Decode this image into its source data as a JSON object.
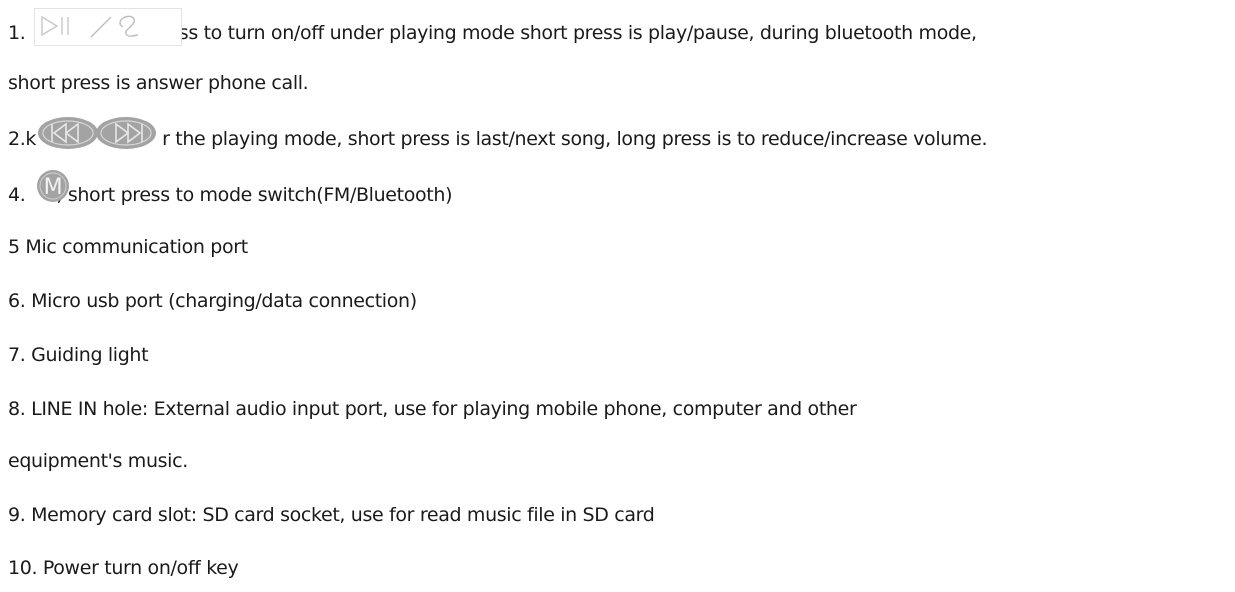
{
  "lines": {
    "l1_prefix": "1.",
    "l1_rest": "ess to turn on/off under playing mode short press is play/pause, during bluetooth mode,",
    "l2": "short press is answer phone call.",
    "l3_prefix": "2.k",
    "l3_rest": "r the playing mode, short press is last/next song, long press is to reduce/increase volume.",
    "l4_prefix": "4.",
    "l4_rest": ", short press to mode switch(FM/Bluetooth)",
    "l5": "5 Mic communication port",
    "l6": "6. Micro usb  port (charging/data connection)",
    "l7": "7. Guiding light",
    "l8": "8. LINE IN hole: External audio input port, use for playing mobile phone, computer and other",
    "l9": "equipment's music.",
    "l10": "9. Memory card slot: SD card socket, use for read music file in SD card",
    "l11": "10. Power turn on/off key"
  },
  "icons": {
    "play_pause_key": "play-pause-phone-icon",
    "prev_next_keys": "prev-next-icon",
    "mode_key": "mode-m-icon",
    "mode_key_glyph": "M"
  },
  "colors": {
    "text": "#1a1a1a",
    "icon_grey": "#9a9a9a",
    "icon_light": "#c8c8c8"
  }
}
